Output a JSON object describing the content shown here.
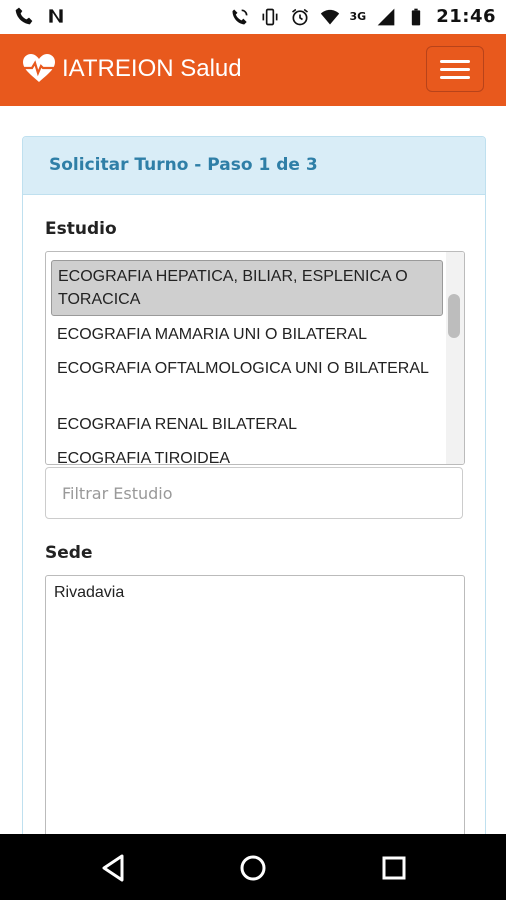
{
  "status_bar": {
    "network": "3G",
    "time": "21:46"
  },
  "header": {
    "title": "IATREION Salud",
    "menu_icon": "hamburger-menu-icon",
    "accent": "#E8591D"
  },
  "panel": {
    "title": "Solicitar Turno - Paso 1 de 3"
  },
  "estudio": {
    "label": "Estudio",
    "options": [
      "ECOGRAFIA HEPATICA, BILIAR, ESPLENICA O TORACICA",
      "ECOGRAFIA MAMARIA UNI O BILATERAL",
      "ECOGRAFIA OFTALMOLOGICA UNI O BILATERAL",
      "ECOGRAFIA RENAL BILATERAL",
      "ECOGRAFIA TIROIDEA"
    ],
    "selected_index": 0,
    "filter_placeholder": "Filtrar Estudio"
  },
  "sede": {
    "label": "Sede",
    "options": [
      "Rivadavia"
    ]
  }
}
